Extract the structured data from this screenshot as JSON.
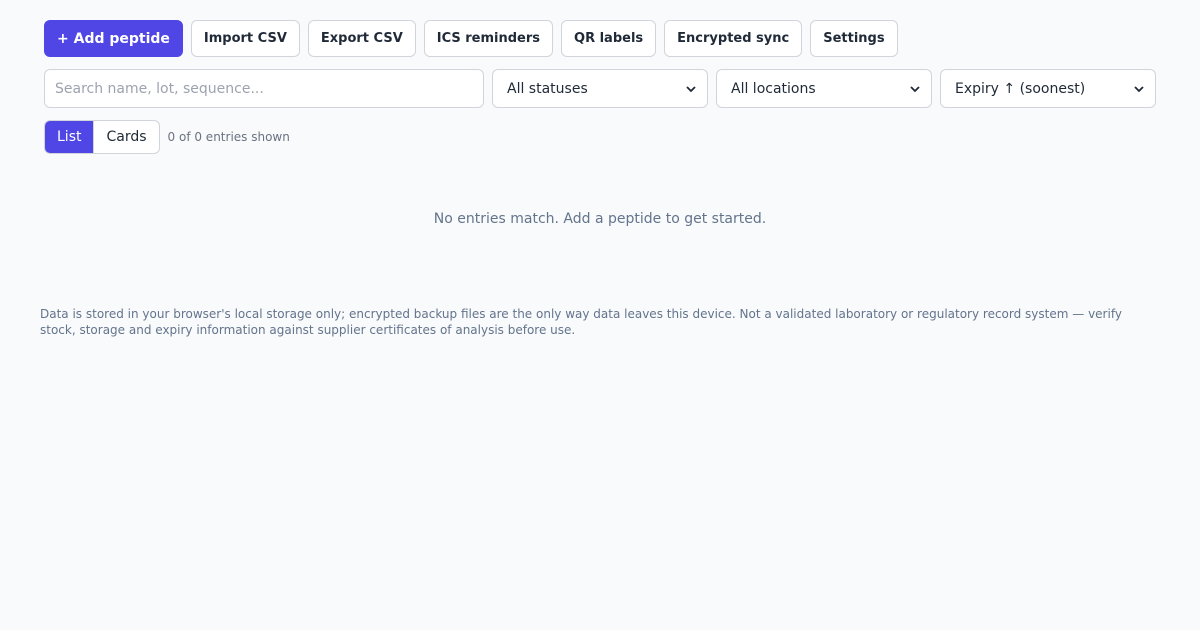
{
  "toolbar": {
    "add_label": "+ Add peptide",
    "import_label": "Import CSV",
    "export_label": "Export CSV",
    "ics_label": "ICS reminders",
    "qr_label": "QR labels",
    "sync_label": "Encrypted sync",
    "settings_label": "Settings"
  },
  "filters": {
    "search_placeholder": "Search name, lot, sequence...",
    "status_value": "All statuses",
    "location_value": "All locations",
    "sort_value": "Expiry ↑ (soonest)"
  },
  "view": {
    "list_label": "List",
    "cards_label": "Cards",
    "active": "List",
    "count_text": "0 of 0 entries shown"
  },
  "empty_state": "No entries match. Add a peptide to get started.",
  "footer_text": "Data is stored in your browser's local storage only; encrypted backup files are the only way data leaves this device. Not a validated laboratory or regulatory record system — verify stock, storage and expiry information against supplier certificates of analysis before use.",
  "colors": {
    "accent": "#4f46e5",
    "background": "#f8fafc",
    "muted_text": "#64748b"
  },
  "icons": {
    "select_arrow": "chevron-down-icon"
  }
}
